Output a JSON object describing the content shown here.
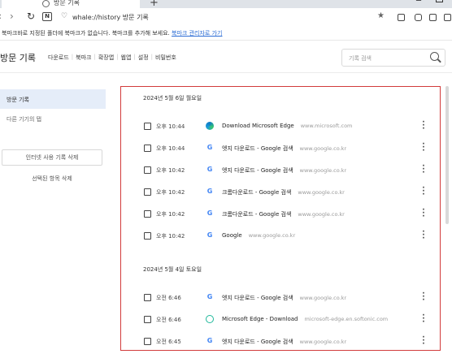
{
  "window": {
    "tab_title": "방문 기록",
    "add_tab": "+",
    "minimize": "─"
  },
  "toolbar": {
    "url_icon": "♡",
    "url": "whale://history 방문 기록",
    "nav_n": "N"
  },
  "bookmark_bar": {
    "text": "북마크바로 지정된 폴더에 북마크가 없습니다. 북마크를 추가해 보세요.",
    "link": "북마크 관리자로 가기"
  },
  "header": {
    "title": "방문 기록",
    "tabs": [
      "다운로드",
      "북마크",
      "확장앱",
      "웹앱",
      "설정",
      "비밀번호"
    ],
    "search_placeholder": "기록 검색"
  },
  "sidebar": {
    "active_item": "방문 기록",
    "other_item": "다른 기기의 탭",
    "clear_button": "인터넷 사용 기록 삭제",
    "delete_selected": "선택된 항목 삭제"
  },
  "history": {
    "groups": [
      {
        "date": "2024년 5월 6일 월요일",
        "entries": [
          {
            "time": "오후 10:44",
            "icon": "edge-icon",
            "title": "Download Microsoft Edge",
            "domain": "www.microsoft.com"
          },
          {
            "time": "오후 10:44",
            "icon": "google-icon",
            "title": "엣지 다운로드 - Google 검색",
            "domain": "www.google.co.kr"
          },
          {
            "time": "오후 10:42",
            "icon": "google-icon",
            "title": "엣지 다운로드 - Google 검색",
            "domain": "www.google.co.kr"
          },
          {
            "time": "오후 10:42",
            "icon": "google-icon",
            "title": "크롬다운로드 - Google 검색",
            "domain": "www.google.co.kr"
          },
          {
            "time": "오후 10:42",
            "icon": "google-icon",
            "title": "크롬다운로드 - Google 검색",
            "domain": "www.google.co.kr"
          },
          {
            "time": "오후 10:42",
            "icon": "google-icon",
            "title": "Google",
            "domain": "www.google.co.kr"
          }
        ]
      },
      {
        "date": "2024년 5월 4일 토요일",
        "entries": [
          {
            "time": "오전 6:46",
            "icon": "google-icon",
            "title": "엣지 다운로드 - Google 검색",
            "domain": "www.google.co.kr"
          },
          {
            "time": "오전 6:46",
            "icon": "softonic-icon",
            "title": "Microsoft Edge - Download",
            "domain": "microsoft-edge.en.softonic.com"
          },
          {
            "time": "오전 6:45",
            "icon": "google-icon",
            "title": "엣지 다운로드 - Google 검색",
            "domain": "www.google.co.kr"
          }
        ]
      }
    ]
  },
  "colors": {
    "highlight_border": "#d23b3b",
    "sidebar_active": "#e5edf9",
    "link": "#2b6cd4"
  }
}
